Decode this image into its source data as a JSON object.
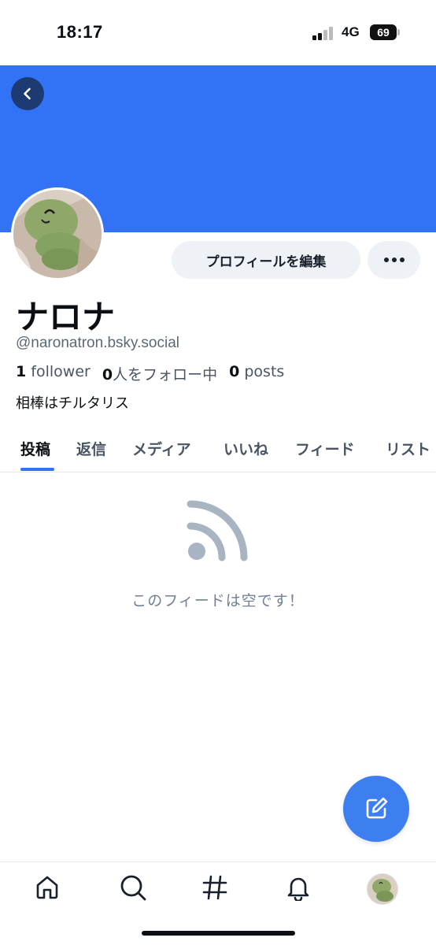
{
  "status_bar": {
    "time": "18:17",
    "network": "4G",
    "battery": "69"
  },
  "profile": {
    "display_name": "ナロナ",
    "handle": "@naronatron.bsky.social",
    "followers_count": "1",
    "followers_label": "follower",
    "following_count": "0",
    "following_label": "人をフォロー中",
    "posts_count": "0",
    "posts_label": "posts",
    "bio": "相棒はチルタリス",
    "edit_label": "プロフィールを編集",
    "banner_color": "#3273f5"
  },
  "tabs": [
    {
      "label": "投稿",
      "active": true
    },
    {
      "label": "返信",
      "active": false
    },
    {
      "label": "メディア",
      "active": false
    },
    {
      "label": "いいね",
      "active": false
    },
    {
      "label": "フィード",
      "active": false
    },
    {
      "label": "リスト",
      "active": false
    }
  ],
  "empty_state": {
    "icon": "rss-feed-icon",
    "text": "このフィードは空です！"
  },
  "fab": {
    "icon": "compose-icon",
    "color": "#3d7ef0"
  },
  "bottom_nav": [
    {
      "icon": "home-icon"
    },
    {
      "icon": "search-icon"
    },
    {
      "icon": "hashtag-icon"
    },
    {
      "icon": "bell-icon"
    },
    {
      "icon": "avatar"
    }
  ]
}
